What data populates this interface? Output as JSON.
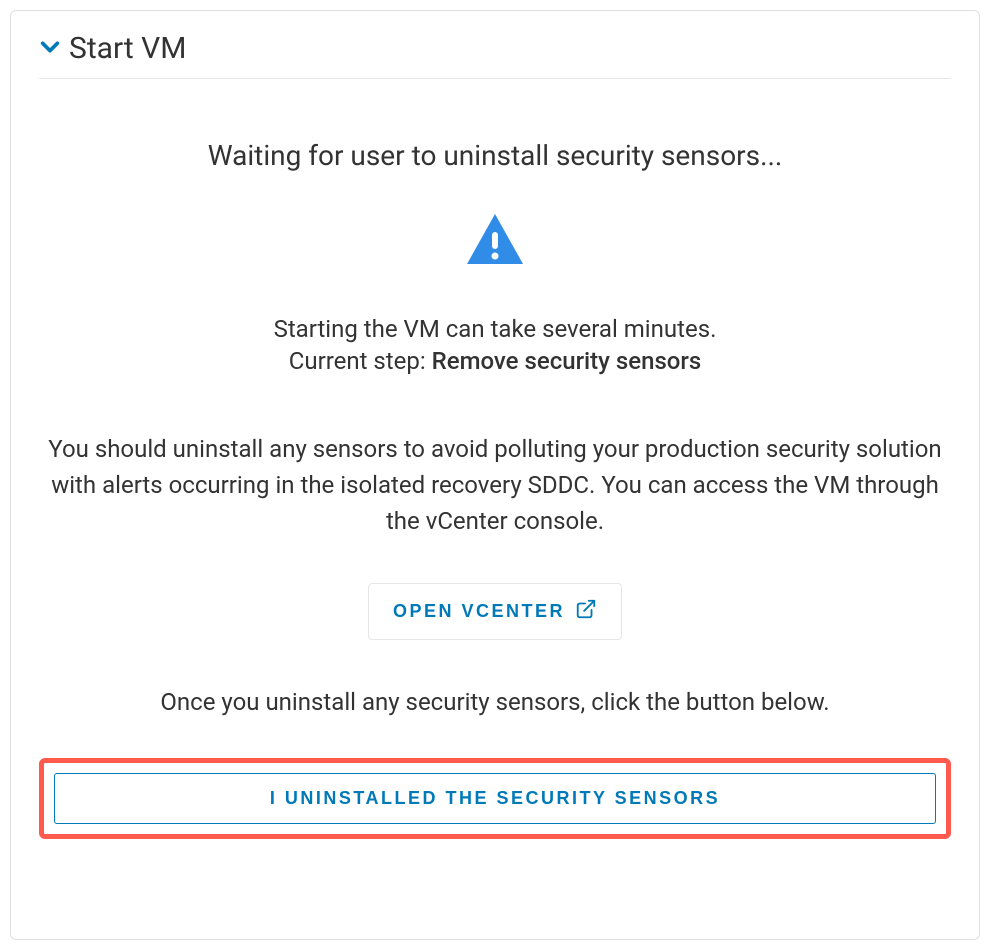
{
  "panel": {
    "title": "Start VM"
  },
  "status": {
    "heading": "Waiting for user to uninstall security sensors...",
    "info_line": "Starting the VM can take several minutes.",
    "step_label": "Current step: ",
    "step_value": "Remove security sensors",
    "description": "You should uninstall any sensors to avoid polluting your production security solution with alerts occurring in the isolated recovery SDDC. You can access the VM through the vCenter console.",
    "instruction": "Once you uninstall any security sensors, click the button below."
  },
  "buttons": {
    "open_vcenter": "OPEN VCENTER",
    "uninstalled": "I UNINSTALLED THE SECURITY SENSORS"
  },
  "colors": {
    "accent": "#0079b8",
    "warning": "#318ce7",
    "highlight": "#ff5a4d"
  }
}
